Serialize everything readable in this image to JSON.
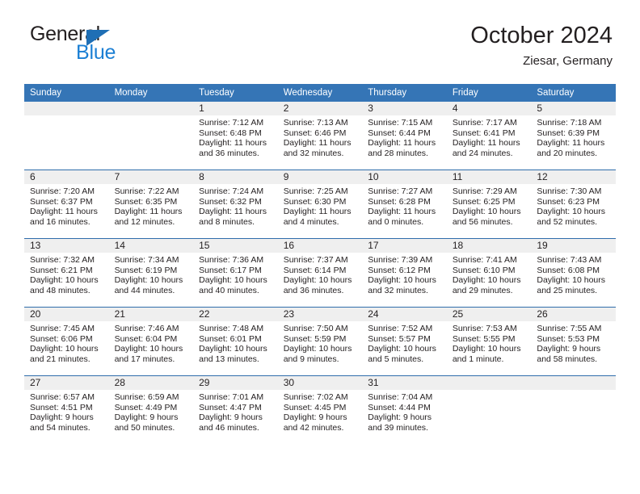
{
  "brand": {
    "name_top": "General",
    "name_bottom": "Blue",
    "triangle_color": "#1f6fb5",
    "blue_text_color": "#1b7fd4"
  },
  "header": {
    "title": "October 2024",
    "subtitle": "Ziesar, Germany"
  },
  "theme": {
    "header_row_bg": "#3575b6",
    "week_divider": "#2f6dab",
    "daynum_band_bg": "#efefef",
    "text": "#231f20"
  },
  "weekday_headers": [
    "Sunday",
    "Monday",
    "Tuesday",
    "Wednesday",
    "Thursday",
    "Friday",
    "Saturday"
  ],
  "labels": {
    "sunrise": "Sunrise:",
    "sunset": "Sunset:",
    "daylight": "Daylight:"
  },
  "weeks": [
    [
      {
        "day": ""
      },
      {
        "day": ""
      },
      {
        "day": "1",
        "sunrise": "Sunrise: 7:12 AM",
        "sunset": "Sunset: 6:48 PM",
        "daylight": "Daylight: 11 hours and 36 minutes."
      },
      {
        "day": "2",
        "sunrise": "Sunrise: 7:13 AM",
        "sunset": "Sunset: 6:46 PM",
        "daylight": "Daylight: 11 hours and 32 minutes."
      },
      {
        "day": "3",
        "sunrise": "Sunrise: 7:15 AM",
        "sunset": "Sunset: 6:44 PM",
        "daylight": "Daylight: 11 hours and 28 minutes."
      },
      {
        "day": "4",
        "sunrise": "Sunrise: 7:17 AM",
        "sunset": "Sunset: 6:41 PM",
        "daylight": "Daylight: 11 hours and 24 minutes."
      },
      {
        "day": "5",
        "sunrise": "Sunrise: 7:18 AM",
        "sunset": "Sunset: 6:39 PM",
        "daylight": "Daylight: 11 hours and 20 minutes."
      }
    ],
    [
      {
        "day": "6",
        "sunrise": "Sunrise: 7:20 AM",
        "sunset": "Sunset: 6:37 PM",
        "daylight": "Daylight: 11 hours and 16 minutes."
      },
      {
        "day": "7",
        "sunrise": "Sunrise: 7:22 AM",
        "sunset": "Sunset: 6:35 PM",
        "daylight": "Daylight: 11 hours and 12 minutes."
      },
      {
        "day": "8",
        "sunrise": "Sunrise: 7:24 AM",
        "sunset": "Sunset: 6:32 PM",
        "daylight": "Daylight: 11 hours and 8 minutes."
      },
      {
        "day": "9",
        "sunrise": "Sunrise: 7:25 AM",
        "sunset": "Sunset: 6:30 PM",
        "daylight": "Daylight: 11 hours and 4 minutes."
      },
      {
        "day": "10",
        "sunrise": "Sunrise: 7:27 AM",
        "sunset": "Sunset: 6:28 PM",
        "daylight": "Daylight: 11 hours and 0 minutes."
      },
      {
        "day": "11",
        "sunrise": "Sunrise: 7:29 AM",
        "sunset": "Sunset: 6:25 PM",
        "daylight": "Daylight: 10 hours and 56 minutes."
      },
      {
        "day": "12",
        "sunrise": "Sunrise: 7:30 AM",
        "sunset": "Sunset: 6:23 PM",
        "daylight": "Daylight: 10 hours and 52 minutes."
      }
    ],
    [
      {
        "day": "13",
        "sunrise": "Sunrise: 7:32 AM",
        "sunset": "Sunset: 6:21 PM",
        "daylight": "Daylight: 10 hours and 48 minutes."
      },
      {
        "day": "14",
        "sunrise": "Sunrise: 7:34 AM",
        "sunset": "Sunset: 6:19 PM",
        "daylight": "Daylight: 10 hours and 44 minutes."
      },
      {
        "day": "15",
        "sunrise": "Sunrise: 7:36 AM",
        "sunset": "Sunset: 6:17 PM",
        "daylight": "Daylight: 10 hours and 40 minutes."
      },
      {
        "day": "16",
        "sunrise": "Sunrise: 7:37 AM",
        "sunset": "Sunset: 6:14 PM",
        "daylight": "Daylight: 10 hours and 36 minutes."
      },
      {
        "day": "17",
        "sunrise": "Sunrise: 7:39 AM",
        "sunset": "Sunset: 6:12 PM",
        "daylight": "Daylight: 10 hours and 32 minutes."
      },
      {
        "day": "18",
        "sunrise": "Sunrise: 7:41 AM",
        "sunset": "Sunset: 6:10 PM",
        "daylight": "Daylight: 10 hours and 29 minutes."
      },
      {
        "day": "19",
        "sunrise": "Sunrise: 7:43 AM",
        "sunset": "Sunset: 6:08 PM",
        "daylight": "Daylight: 10 hours and 25 minutes."
      }
    ],
    [
      {
        "day": "20",
        "sunrise": "Sunrise: 7:45 AM",
        "sunset": "Sunset: 6:06 PM",
        "daylight": "Daylight: 10 hours and 21 minutes."
      },
      {
        "day": "21",
        "sunrise": "Sunrise: 7:46 AM",
        "sunset": "Sunset: 6:04 PM",
        "daylight": "Daylight: 10 hours and 17 minutes."
      },
      {
        "day": "22",
        "sunrise": "Sunrise: 7:48 AM",
        "sunset": "Sunset: 6:01 PM",
        "daylight": "Daylight: 10 hours and 13 minutes."
      },
      {
        "day": "23",
        "sunrise": "Sunrise: 7:50 AM",
        "sunset": "Sunset: 5:59 PM",
        "daylight": "Daylight: 10 hours and 9 minutes."
      },
      {
        "day": "24",
        "sunrise": "Sunrise: 7:52 AM",
        "sunset": "Sunset: 5:57 PM",
        "daylight": "Daylight: 10 hours and 5 minutes."
      },
      {
        "day": "25",
        "sunrise": "Sunrise: 7:53 AM",
        "sunset": "Sunset: 5:55 PM",
        "daylight": "Daylight: 10 hours and 1 minute."
      },
      {
        "day": "26",
        "sunrise": "Sunrise: 7:55 AM",
        "sunset": "Sunset: 5:53 PM",
        "daylight": "Daylight: 9 hours and 58 minutes."
      }
    ],
    [
      {
        "day": "27",
        "sunrise": "Sunrise: 6:57 AM",
        "sunset": "Sunset: 4:51 PM",
        "daylight": "Daylight: 9 hours and 54 minutes."
      },
      {
        "day": "28",
        "sunrise": "Sunrise: 6:59 AM",
        "sunset": "Sunset: 4:49 PM",
        "daylight": "Daylight: 9 hours and 50 minutes."
      },
      {
        "day": "29",
        "sunrise": "Sunrise: 7:01 AM",
        "sunset": "Sunset: 4:47 PM",
        "daylight": "Daylight: 9 hours and 46 minutes."
      },
      {
        "day": "30",
        "sunrise": "Sunrise: 7:02 AM",
        "sunset": "Sunset: 4:45 PM",
        "daylight": "Daylight: 9 hours and 42 minutes."
      },
      {
        "day": "31",
        "sunrise": "Sunrise: 7:04 AM",
        "sunset": "Sunset: 4:44 PM",
        "daylight": "Daylight: 9 hours and 39 minutes."
      },
      {
        "day": ""
      },
      {
        "day": ""
      }
    ]
  ]
}
